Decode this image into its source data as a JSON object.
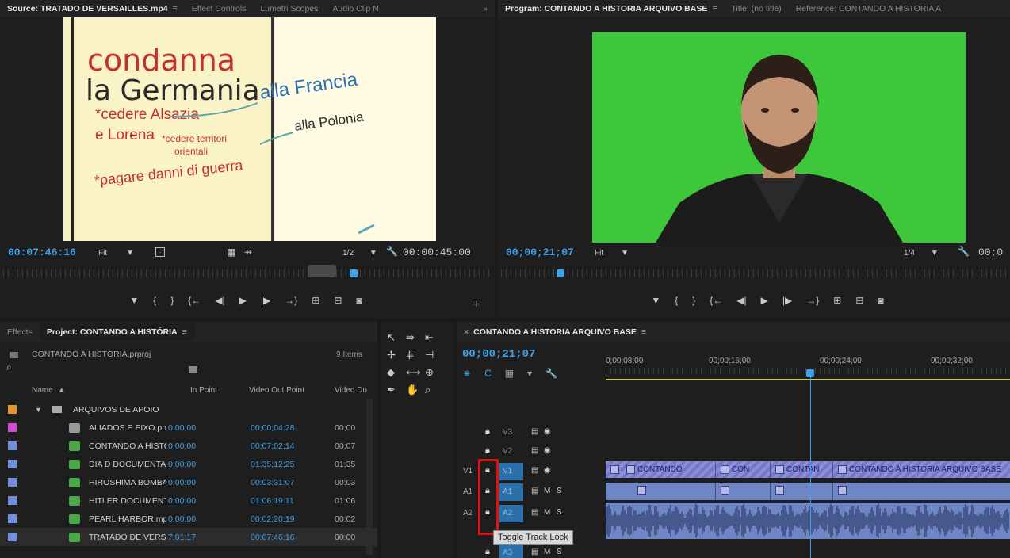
{
  "source_monitor": {
    "tabs": [
      {
        "label": "Source: TRATADO DE VERSAILLES.mp4",
        "menu": "≡"
      },
      {
        "label": "Effect Controls"
      },
      {
        "label": "Lumetri Scopes"
      },
      {
        "label": "Audio Clip N"
      }
    ],
    "overflow": "»",
    "video_text": {
      "line1": "condanna",
      "line2": "la Germania",
      "line3": "*cedere Alsazia",
      "line4": "e Lorena",
      "line5": "*cedere territori",
      "line6": "orientali",
      "line7": "*pagare danni di guerra",
      "right1": "alla Francia",
      "right2": "alla Polonia"
    },
    "timecode": "00:07:46:16",
    "fit": "Fit",
    "resolution": "1/2",
    "duration": "00:00:45:00",
    "playhead_fraction": 0.71,
    "add_icon": "+"
  },
  "program_monitor": {
    "tabs": [
      {
        "label": "Program: CONTANDO A HISTORIA ARQUIVO BASE",
        "menu": "≡"
      },
      {
        "label": "Title: (no title)"
      },
      {
        "label": "Reference: CONTANDO A HISTORIA A"
      }
    ],
    "timecode": "00;00;21;07",
    "fit": "Fit",
    "resolution": "1/4",
    "duration": "00;0",
    "playhead_fraction": 0.11,
    "background_color": "#3ec73a"
  },
  "project_panel": {
    "tabs": [
      {
        "label": "Effects"
      },
      {
        "label": "Project: CONTANDO A HISTÓRIA",
        "menu": "≡"
      }
    ],
    "project_file": "CONTANDO A HISTÓRIA.prproj",
    "item_count": "9 Items",
    "columns": {
      "name": "Name",
      "in_point": "In Point",
      "out_point": "Video Out Point",
      "duration": "Video Du"
    },
    "folder": {
      "name": "ARQUIVOS DE APOIO",
      "color": "#e8952f"
    },
    "items": [
      {
        "name": "ALIADOS E EIXO.png",
        "in": "0;00;00",
        "out": "00;00;04;28",
        "dur": "00;00",
        "color": "#d44ad4",
        "icon_color": "#9a9a9a"
      },
      {
        "name": "CONTANDO A HISTOR",
        "in": "0;00;00",
        "out": "00;07;02;14",
        "dur": "00;07",
        "color": "#6f8fdf",
        "icon_color": "#4aa84a"
      },
      {
        "name": "DIA D DOCUMENTARI",
        "in": "0;00;00",
        "out": "01;35;12;25",
        "dur": "01;35",
        "color": "#6f8fdf",
        "icon_color": "#4aa84a"
      },
      {
        "name": "HIROSHIMA BOMBA.m",
        "in": "0:00:00",
        "out": "00:03:31:07",
        "dur": "00:03",
        "color": "#6f8fdf",
        "icon_color": "#4aa84a"
      },
      {
        "name": "HITLER DOCUMENTAR",
        "in": "0:00:00",
        "out": "01:06:19:11",
        "dur": "01:06",
        "color": "#6f8fdf",
        "icon_color": "#4aa84a"
      },
      {
        "name": "PEARL HARBOR.mp4",
        "in": "0:00:00",
        "out": "00:02:20:19",
        "dur": "00:02",
        "color": "#6f8fdf",
        "icon_color": "#4aa84a"
      },
      {
        "name": "TRATADO DE VERSAIL",
        "in": "7:01:17",
        "out": "00:07:46:16",
        "dur": "00:00",
        "color": "#6f8fdf",
        "icon_color": "#4aa84a"
      }
    ]
  },
  "timeline": {
    "close": "×",
    "sequence_name": "CONTANDO A HISTORIA ARQUIVO BASE",
    "menu": "≡",
    "timecode": "00;00;21;07",
    "ruler_labels": [
      "0;00;08;00",
      "00;00;16;00",
      "00;00;24;00",
      "00;00;32;00"
    ],
    "tracks": [
      {
        "name": "V3",
        "type": "video"
      },
      {
        "name": "V2",
        "type": "video"
      },
      {
        "name": "V1",
        "source": "V1",
        "type": "video"
      },
      {
        "name": "A1",
        "source": "A1",
        "type": "audio"
      },
      {
        "name": "A2",
        "source": "A2",
        "type": "audio"
      },
      {
        "name": "A3",
        "type": "audio"
      }
    ],
    "track_buttons": {
      "mute": "M",
      "solo": "S"
    },
    "v1_clips": [
      "CONTANDO",
      "CON",
      "CONTAN",
      "CONTANDO A HISTORIA ARQUIVO BASE"
    ],
    "tooltip": "Toggle Track Lock"
  }
}
